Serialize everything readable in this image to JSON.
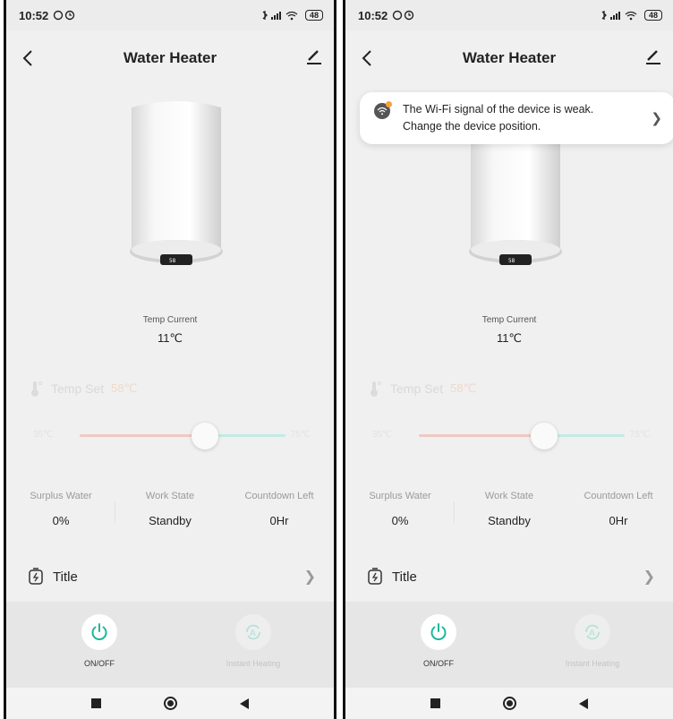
{
  "status_bar": {
    "time": "10:52",
    "battery": "48"
  },
  "header": {
    "title": "Water Heater"
  },
  "heater": {
    "display_value": "58"
  },
  "temp_current": {
    "label": "Temp Current",
    "value": "11℃"
  },
  "temp_set": {
    "label": "Temp Set",
    "value": "58℃"
  },
  "slider": {
    "min_label": "35℃",
    "max_label": "75℃",
    "fraction": 0.6
  },
  "stats": [
    {
      "label": "Surplus Water",
      "value": "0%"
    },
    {
      "label": "Work State",
      "value": "Standby"
    },
    {
      "label": "Countdown Left",
      "value": "0Hr"
    }
  ],
  "title_row": {
    "label": "Title"
  },
  "buttons": {
    "onoff": "ON/OFF",
    "instant": "Instant Heating"
  },
  "toast": {
    "line1": "The Wi-Fi signal of the device is weak.",
    "line2": "Change the device position."
  },
  "colors": {
    "accent": "#1bb89a",
    "slider_warm": "#f0c8c2",
    "slider_cool": "#c4ebe3",
    "warning_dot": "#f6a13b"
  },
  "icons": [
    "back-icon",
    "edit-icon",
    "thermometer-icon",
    "power-icon",
    "auto-heat-icon",
    "timer-icon",
    "wifi-warning-icon",
    "chevron-right-icon"
  ]
}
